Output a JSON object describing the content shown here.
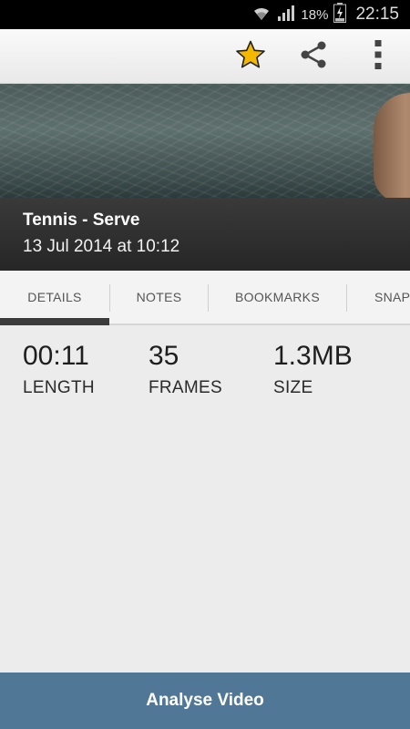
{
  "status_bar": {
    "battery_percent": "18%",
    "time": "22:15",
    "icons": [
      "wifi-icon",
      "signal-icon",
      "battery-charging-icon"
    ]
  },
  "action_bar": {
    "icons": [
      "star-icon",
      "share-icon",
      "overflow-menu-icon"
    ],
    "star_color": "#f5b800"
  },
  "video": {
    "title": "Tennis - Serve",
    "date": "13 Jul 2014 at 10:12"
  },
  "tabs": [
    {
      "label": "DETAILS",
      "selected": true
    },
    {
      "label": "NOTES",
      "selected": false
    },
    {
      "label": "BOOKMARKS",
      "selected": false
    },
    {
      "label": "SNAP",
      "selected": false
    }
  ],
  "stats": {
    "length": {
      "value": "00:11",
      "label": "LENGTH"
    },
    "frames": {
      "value": "35",
      "label": "FRAMES"
    },
    "size": {
      "value": "1.3MB",
      "label": "SIZE"
    }
  },
  "analyse_button": {
    "label": "Analyse Video",
    "color": "#507896"
  }
}
